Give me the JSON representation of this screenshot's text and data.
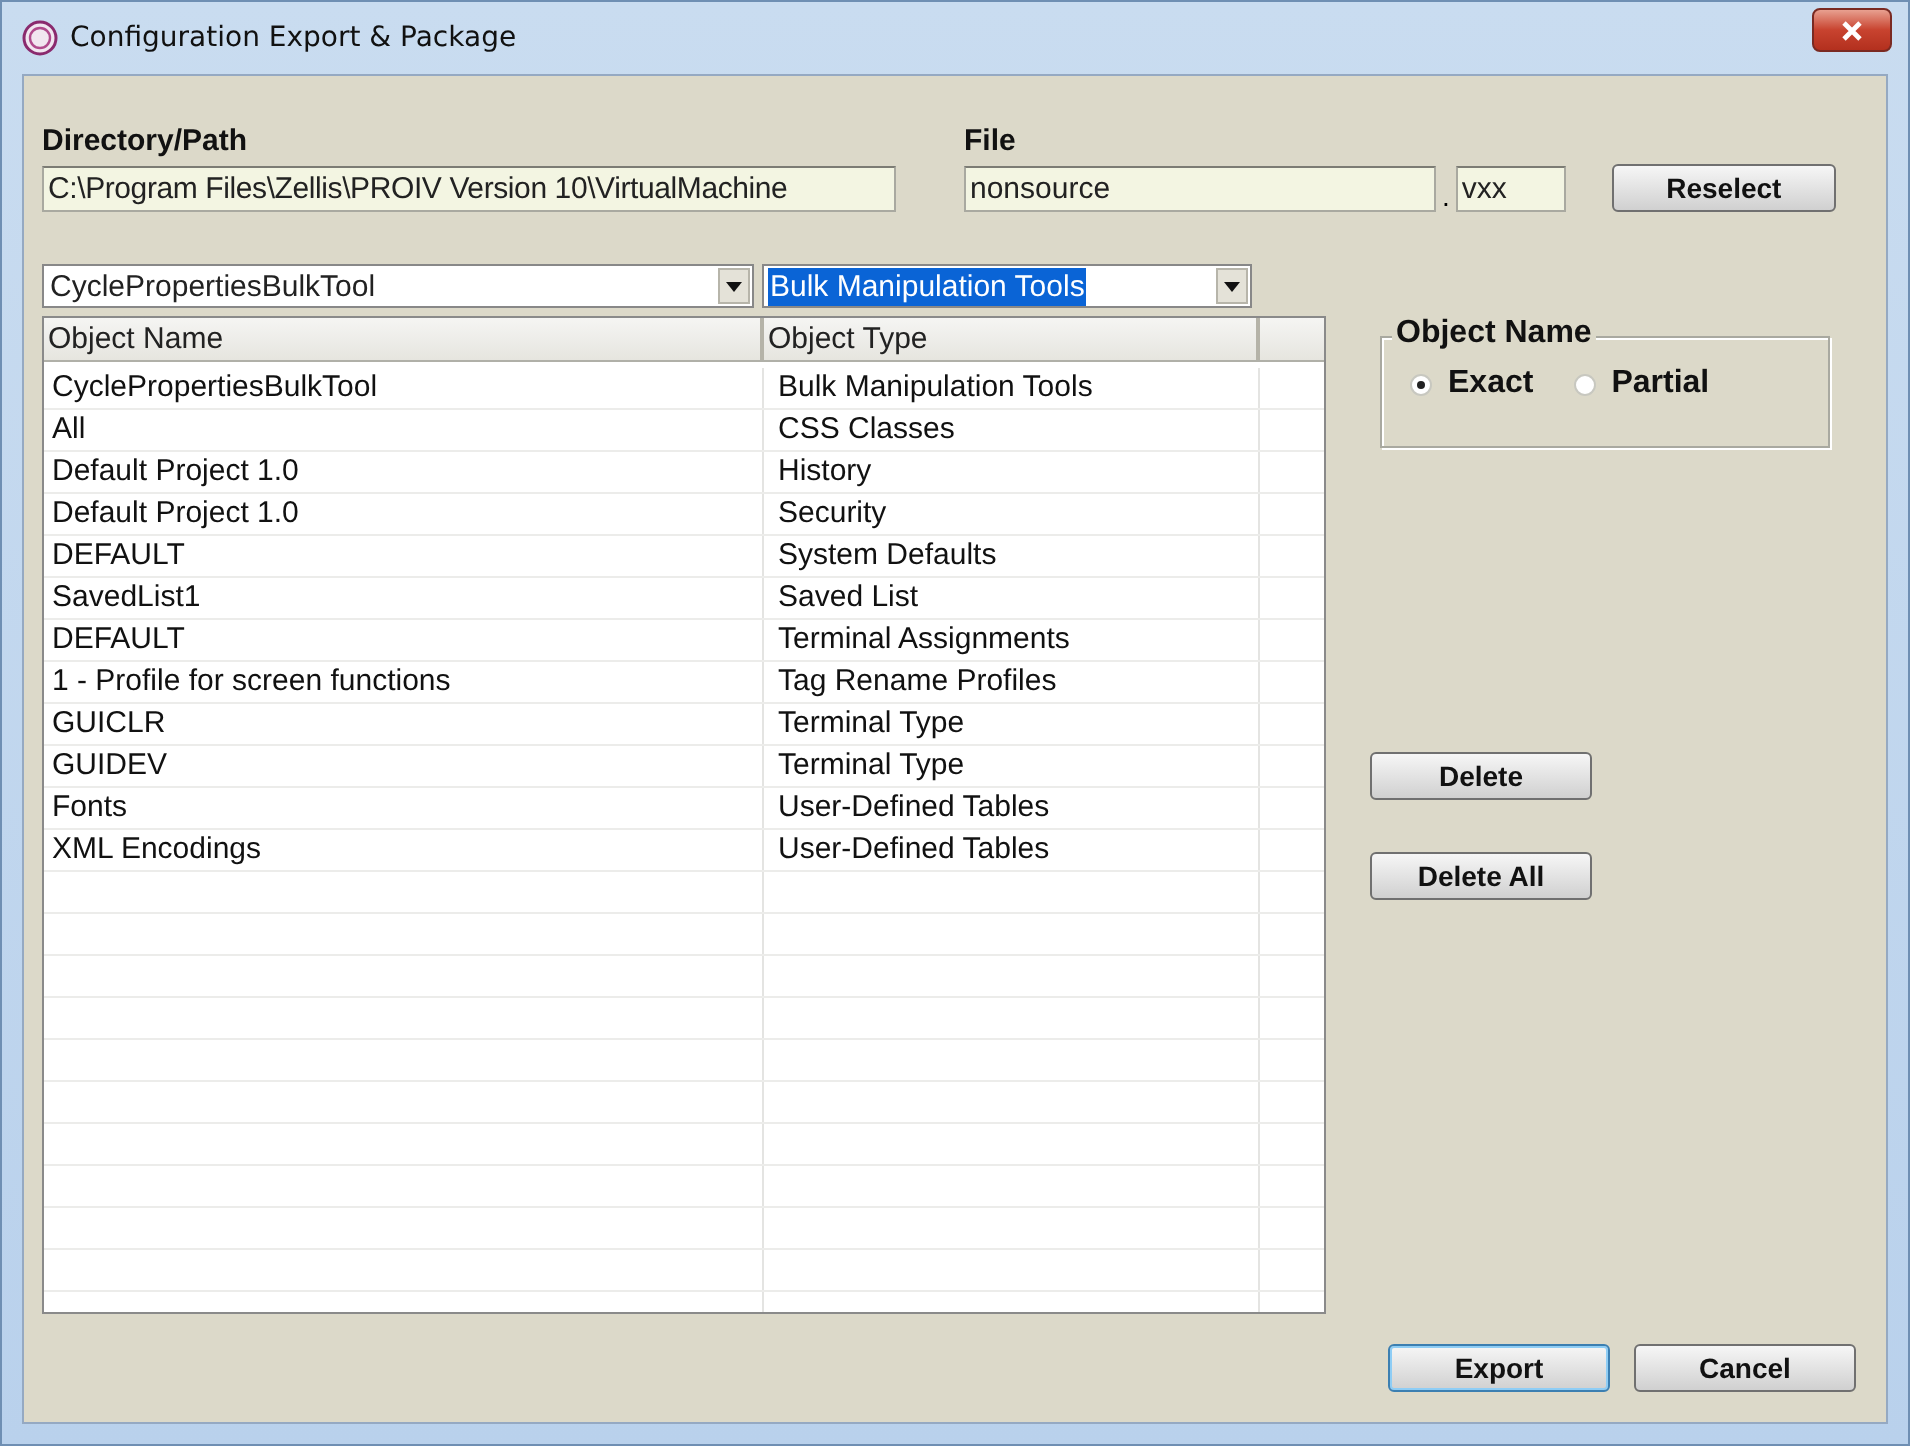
{
  "window": {
    "title": "Configuration Export & Package"
  },
  "directory": {
    "label": "Directory/Path",
    "value": "C:\\Program Files\\Zellis\\PROIV Version 10\\VirtualMachine"
  },
  "file": {
    "label": "File",
    "name": "nonsource",
    "separator": ".",
    "extension": "vxx"
  },
  "reselect_button": "Reselect",
  "filters": [
    {
      "value": "CyclePropertiesBulkTool",
      "highlighted": false
    },
    {
      "value": "Bulk Manipulation Tools",
      "highlighted": true
    }
  ],
  "table": {
    "columns": [
      "Object Name",
      "Object Type"
    ],
    "rows": [
      {
        "name": "CyclePropertiesBulkTool",
        "type": "Bulk Manipulation Tools"
      },
      {
        "name": "All",
        "type": "CSS Classes"
      },
      {
        "name": "Default Project 1.0",
        "type": "History"
      },
      {
        "name": "Default Project 1.0",
        "type": "Security"
      },
      {
        "name": "DEFAULT",
        "type": "System Defaults"
      },
      {
        "name": "SavedList1",
        "type": "Saved List"
      },
      {
        "name": "DEFAULT",
        "type": "Terminal Assignments"
      },
      {
        "name": "1 - Profile for screen functions",
        "type": "Tag Rename Profiles"
      },
      {
        "name": "GUICLR",
        "type": "Terminal Type"
      },
      {
        "name": "GUIDEV",
        "type": "Terminal Type"
      },
      {
        "name": "Fonts",
        "type": "User-Defined Tables"
      },
      {
        "name": "XML Encodings",
        "type": "User-Defined Tables"
      }
    ]
  },
  "object_name_match": {
    "title": "Object Name",
    "options": [
      {
        "label": "Exact",
        "selected": true
      },
      {
        "label": "Partial",
        "selected": false
      }
    ]
  },
  "side_buttons": [
    "Delete",
    "Delete All"
  ],
  "footer_buttons": [
    {
      "label": "Export",
      "default": true
    },
    {
      "label": "Cancel",
      "default": false
    }
  ]
}
